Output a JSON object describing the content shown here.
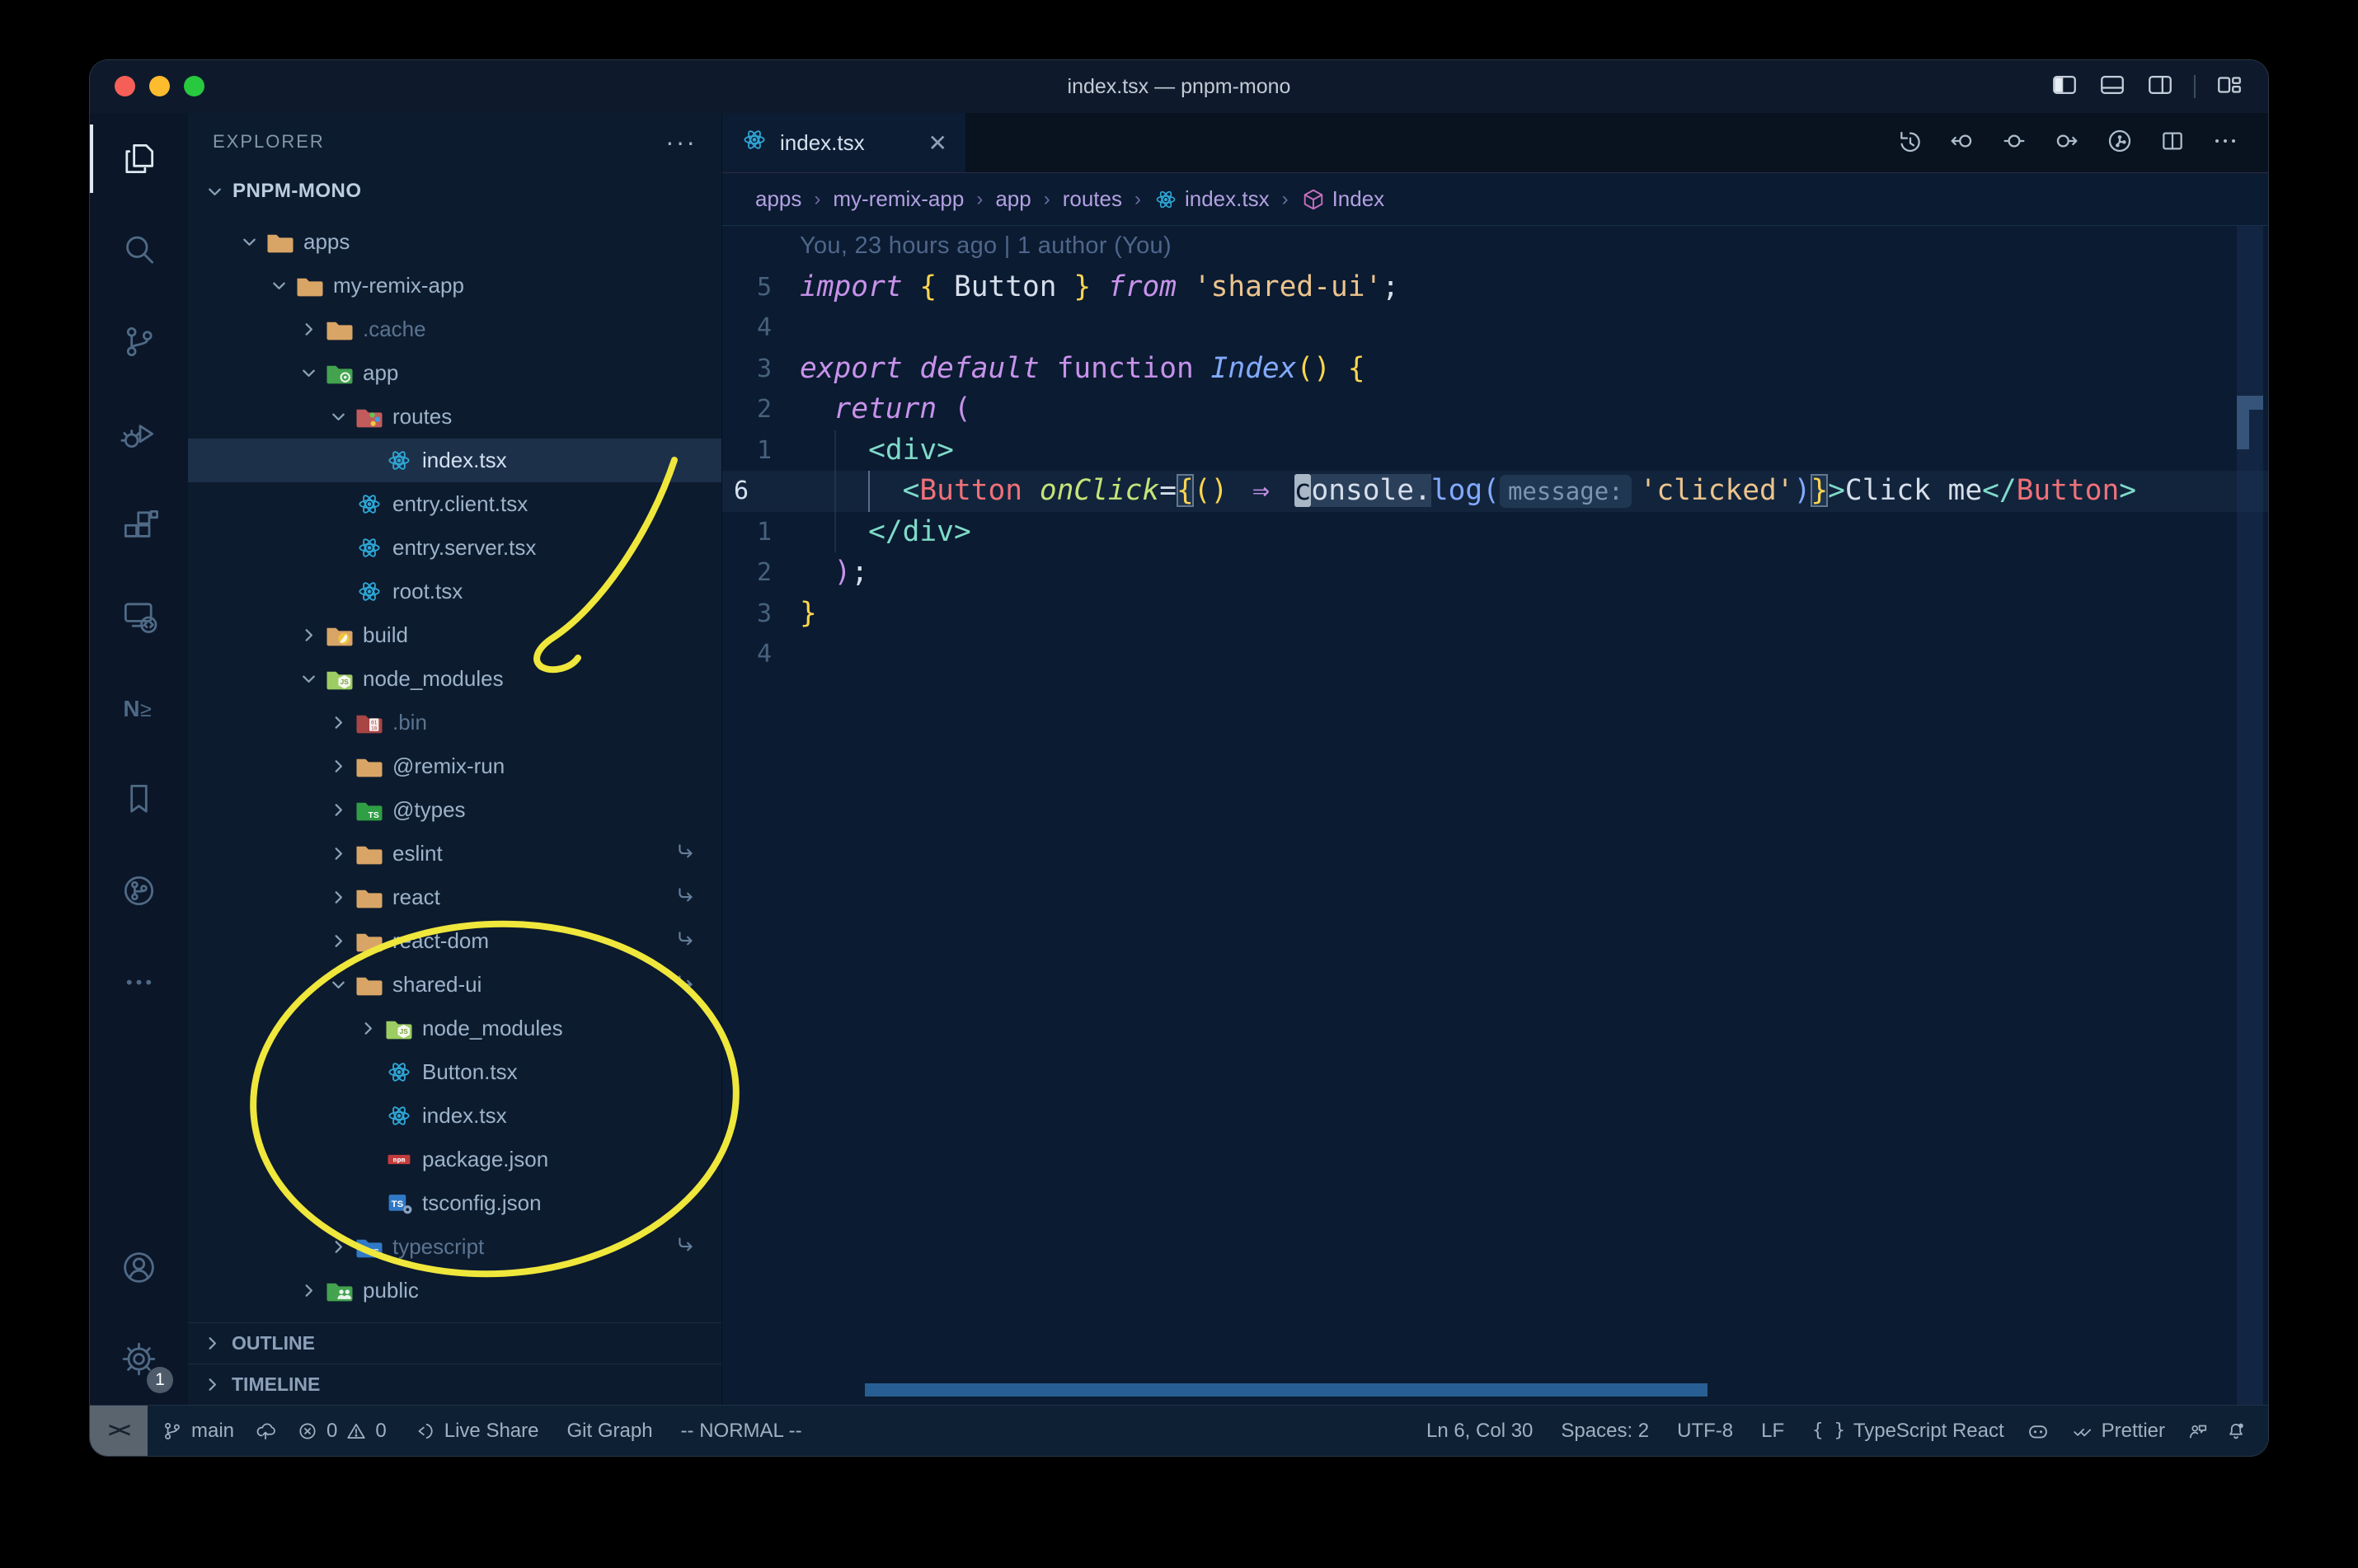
{
  "window": {
    "title": "index.tsx — pnpm-mono"
  },
  "title_bar": {
    "layout_icons": [
      "toggle-primary-sidebar",
      "toggle-panel",
      "toggle-secondary-sidebar",
      "customize-layout"
    ]
  },
  "activity_bar": {
    "items": [
      "explorer",
      "search",
      "source-control",
      "run-and-debug",
      "extensions",
      "remote-explorer",
      "nx-console",
      "bookmarks",
      "git-graph",
      "additional-views"
    ],
    "bottom_items": [
      "accounts",
      "settings"
    ],
    "active": "explorer",
    "settings_badge": "1"
  },
  "explorer": {
    "title": "EXPLORER",
    "root": "PNPM-MONO",
    "sections": [
      "OUTLINE",
      "TIMELINE"
    ],
    "tree": [
      {
        "label": "apps",
        "level": 1,
        "expanded": true,
        "icon": "folder"
      },
      {
        "label": "my-remix-app",
        "level": 2,
        "expanded": true,
        "icon": "folder"
      },
      {
        "label": ".cache",
        "level": 3,
        "expanded": false,
        "icon": "folder",
        "dim": true
      },
      {
        "label": "app",
        "level": 3,
        "expanded": true,
        "icon": "folder-app"
      },
      {
        "label": "routes",
        "level": 4,
        "expanded": true,
        "icon": "folder-routes"
      },
      {
        "label": "index.tsx",
        "level": 5,
        "icon": "react",
        "selected": true
      },
      {
        "label": "entry.client.tsx",
        "level": 4,
        "icon": "react"
      },
      {
        "label": "entry.server.tsx",
        "level": 4,
        "icon": "react"
      },
      {
        "label": "root.tsx",
        "level": 4,
        "icon": "react"
      },
      {
        "label": "build",
        "level": 3,
        "expanded": false,
        "icon": "folder-build"
      },
      {
        "label": "node_modules",
        "level": 3,
        "expanded": true,
        "icon": "folder-node"
      },
      {
        "label": ".bin",
        "level": 4,
        "expanded": false,
        "icon": "folder-bin",
        "dim": true
      },
      {
        "label": "@remix-run",
        "level": 4,
        "expanded": false,
        "icon": "folder"
      },
      {
        "label": "@types",
        "level": 4,
        "expanded": false,
        "icon": "folder-types"
      },
      {
        "label": "eslint",
        "level": 4,
        "expanded": false,
        "icon": "folder",
        "link": true
      },
      {
        "label": "react",
        "level": 4,
        "expanded": false,
        "icon": "folder",
        "link": true
      },
      {
        "label": "react-dom",
        "level": 4,
        "expanded": false,
        "icon": "folder",
        "link": true
      },
      {
        "label": "shared-ui",
        "level": 4,
        "expanded": true,
        "icon": "folder",
        "link": true
      },
      {
        "label": "node_modules",
        "level": 5,
        "expanded": false,
        "icon": "folder-node"
      },
      {
        "label": "Button.tsx",
        "level": 5,
        "icon": "react"
      },
      {
        "label": "index.tsx",
        "level": 5,
        "icon": "react"
      },
      {
        "label": "package.json",
        "level": 5,
        "icon": "npm"
      },
      {
        "label": "tsconfig.json",
        "level": 5,
        "icon": "tsconfig"
      },
      {
        "label": "typescript",
        "level": 4,
        "expanded": false,
        "icon": "folder-ts",
        "dim": true,
        "link": true
      },
      {
        "label": "public",
        "level": 3,
        "expanded": false,
        "icon": "folder-public"
      }
    ]
  },
  "editor": {
    "tab": {
      "label": "index.tsx",
      "icon": "react"
    },
    "toolbar": [
      "timeline",
      "go-back",
      "current-change",
      "go-forward",
      "git-actions",
      "split-editor",
      "more-actions"
    ],
    "breadcrumbs": [
      {
        "label": "apps"
      },
      {
        "label": "my-remix-app"
      },
      {
        "label": "app"
      },
      {
        "label": "routes"
      },
      {
        "label": "index.tsx",
        "icon": "react"
      },
      {
        "label": "Index",
        "icon": "symbol-namespace"
      }
    ],
    "blame": "You, 23 hours ago | 1 author (You)",
    "inlay_hint": "message:",
    "lines": [
      {
        "rel": "5",
        "tokens": [
          [
            "kw",
            "import"
          ],
          [
            "txt",
            " "
          ],
          [
            "b1",
            "{"
          ],
          [
            "txt",
            " Button "
          ],
          [
            "b1",
            "}"
          ],
          [
            "txt",
            " "
          ],
          [
            "kw",
            "from"
          ],
          [
            "txt",
            " "
          ],
          [
            "str",
            "'shared-ui'"
          ],
          [
            "txt",
            ";"
          ]
        ]
      },
      {
        "rel": "4",
        "tokens": []
      },
      {
        "rel": "3",
        "tokens": [
          [
            "kw",
            "export"
          ],
          [
            "txt",
            " "
          ],
          [
            "kw",
            "default"
          ],
          [
            "txt",
            " "
          ],
          [
            "kwu",
            "function"
          ],
          [
            "txt",
            " "
          ],
          [
            "fn",
            "Index"
          ],
          [
            "b1",
            "()"
          ],
          [
            "txt",
            " "
          ],
          [
            "b1",
            "{"
          ]
        ]
      },
      {
        "rel": "2",
        "tokens": [
          [
            "txt",
            "  "
          ],
          [
            "kw",
            "return"
          ],
          [
            "txt",
            " "
          ],
          [
            "b2",
            "("
          ]
        ]
      },
      {
        "rel": "1",
        "g": [
          2
        ],
        "tokens": [
          [
            "txt",
            "    "
          ],
          [
            "tag",
            "<div>"
          ]
        ]
      },
      {
        "rel": "6",
        "current": true,
        "g": [
          2
        ],
        "gb": [
          4
        ],
        "tokens": [
          [
            "txt",
            "      "
          ],
          [
            "tag",
            "<"
          ],
          [
            "cmp",
            "Button"
          ],
          [
            "txt",
            " "
          ],
          [
            "attr",
            "onClick"
          ],
          [
            "txt",
            "="
          ],
          [
            "bm",
            "{"
          ],
          [
            "b1",
            "()"
          ],
          [
            "txt",
            " "
          ],
          [
            "arr",
            "⇒"
          ],
          [
            "txt",
            " "
          ],
          [
            "cur",
            "c"
          ],
          [
            "occ",
            "onsole."
          ],
          [
            "blue",
            "log"
          ],
          [
            "blue",
            "("
          ],
          [
            "inlay",
            "message:"
          ],
          [
            "str",
            "'clicked'"
          ],
          [
            "blue",
            ")"
          ],
          [
            "bm",
            "}"
          ],
          [
            "tag",
            ">"
          ],
          [
            "txt",
            "Click me"
          ],
          [
            "tag",
            "</"
          ],
          [
            "cmp",
            "Button"
          ],
          [
            "tag",
            ">"
          ]
        ]
      },
      {
        "rel": "1",
        "g": [
          2
        ],
        "tokens": [
          [
            "txt",
            "    "
          ],
          [
            "tag",
            "</div>"
          ]
        ]
      },
      {
        "rel": "2",
        "tokens": [
          [
            "txt",
            "  "
          ],
          [
            "b2",
            ")"
          ],
          [
            "txt",
            ";"
          ]
        ]
      },
      {
        "rel": "3",
        "tokens": [
          [
            "b1",
            "}"
          ]
        ]
      },
      {
        "rel": "4",
        "tokens": []
      }
    ]
  },
  "status_bar": {
    "left": [
      {
        "name": "remote",
        "label": ""
      },
      {
        "name": "branch",
        "label": "main"
      },
      {
        "name": "sync",
        "label": ""
      },
      {
        "name": "problems",
        "errors": "0",
        "warnings": "0"
      },
      {
        "name": "live-share",
        "label": "Live Share"
      },
      {
        "name": "git-graph",
        "label": "Git Graph"
      },
      {
        "name": "vim-mode",
        "label": "-- NORMAL --"
      }
    ],
    "right": [
      {
        "name": "cursor-position",
        "label": "Ln 6, Col 30"
      },
      {
        "name": "indentation",
        "label": "Spaces: 2"
      },
      {
        "name": "encoding",
        "label": "UTF-8"
      },
      {
        "name": "eol",
        "label": "LF"
      },
      {
        "name": "language-mode",
        "label": "TypeScript React"
      },
      {
        "name": "copilot",
        "label": ""
      },
      {
        "name": "prettier",
        "label": "Prettier"
      },
      {
        "name": "feedback",
        "label": ""
      },
      {
        "name": "notifications",
        "label": ""
      }
    ]
  },
  "annotations": {
    "color": "#efe73b"
  }
}
